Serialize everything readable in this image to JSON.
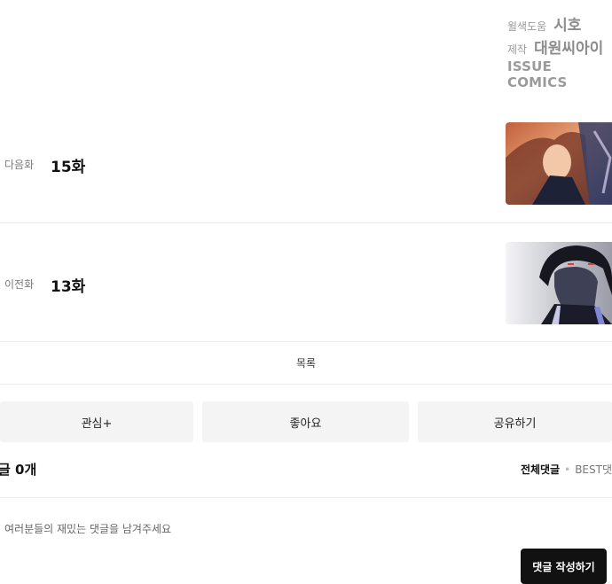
{
  "credits": {
    "rows": [
      {
        "label": "윌색도움",
        "value": "시호"
      },
      {
        "label": "제작",
        "value": "대원씨아이"
      }
    ],
    "publisher": "ISSUE COMICS"
  },
  "episodes": {
    "next": {
      "direction": "다음화",
      "title": "15화"
    },
    "prev": {
      "direction": "이전화",
      "title": "13화"
    }
  },
  "list_label": "목록",
  "actions": {
    "favorite": "관심+",
    "like": "좋아요",
    "share": "공유하기"
  },
  "comments": {
    "count_label": "글 0개",
    "sort_all": "전체댓글",
    "sort_best": "BEST댓",
    "placeholder": "여러분들의 재밌는 댓글을 남겨주세요",
    "write_button": "댓글 작성하기"
  }
}
